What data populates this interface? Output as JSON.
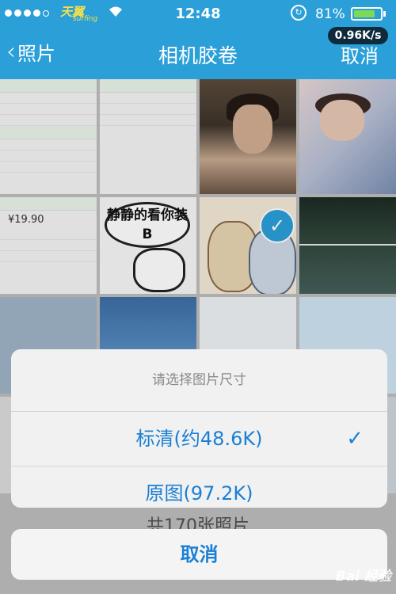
{
  "status_bar": {
    "carrier": "天翼",
    "carrier_sub": "surfing",
    "time": "12:48",
    "battery_percent": "81%",
    "battery_level": 0.81,
    "network_speed": "0.96K/s"
  },
  "nav": {
    "back_label": "照片",
    "title": "相机胶卷",
    "cancel_label": "取消"
  },
  "grid": {
    "selected_index": 7,
    "sticker_text": "静静的看你装B"
  },
  "action_sheet": {
    "prompt": "请选择图片尺寸",
    "options": [
      {
        "label": "标清(约48.6K)",
        "selected": true
      },
      {
        "label": "原图(97.2K)",
        "selected": false
      }
    ],
    "cancel_label": "取消"
  },
  "behind_text": "共170张照片",
  "watermark": "Bai 经验",
  "colors": {
    "nav_bar": "#2a9fd8",
    "accent": "#1a7fd6",
    "battery_fill": "#7ed957"
  }
}
